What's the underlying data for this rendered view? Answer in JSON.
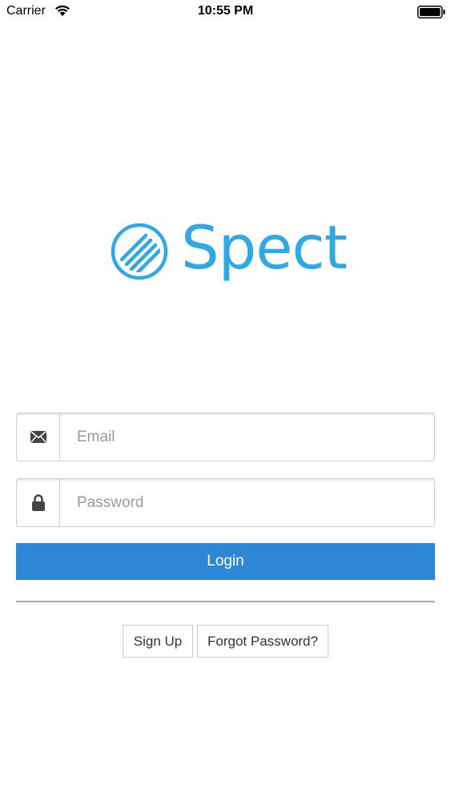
{
  "status_bar": {
    "carrier": "Carrier",
    "time": "10:55 PM",
    "wifi_icon": "wifi-icon",
    "battery_icon": "battery-icon"
  },
  "logo": {
    "wordmark": "Spect",
    "mark_icon": "spect-logo-icon",
    "color": "#2ea9e3"
  },
  "form": {
    "email": {
      "icon": "envelope-icon",
      "placeholder": "Email",
      "value": ""
    },
    "password": {
      "icon": "lock-icon",
      "placeholder": "Password",
      "value": ""
    },
    "login_label": "Login",
    "login_color": "#2e86d6"
  },
  "links": {
    "sign_up_label": "Sign Up",
    "forgot_password_label": "Forgot Password?"
  }
}
